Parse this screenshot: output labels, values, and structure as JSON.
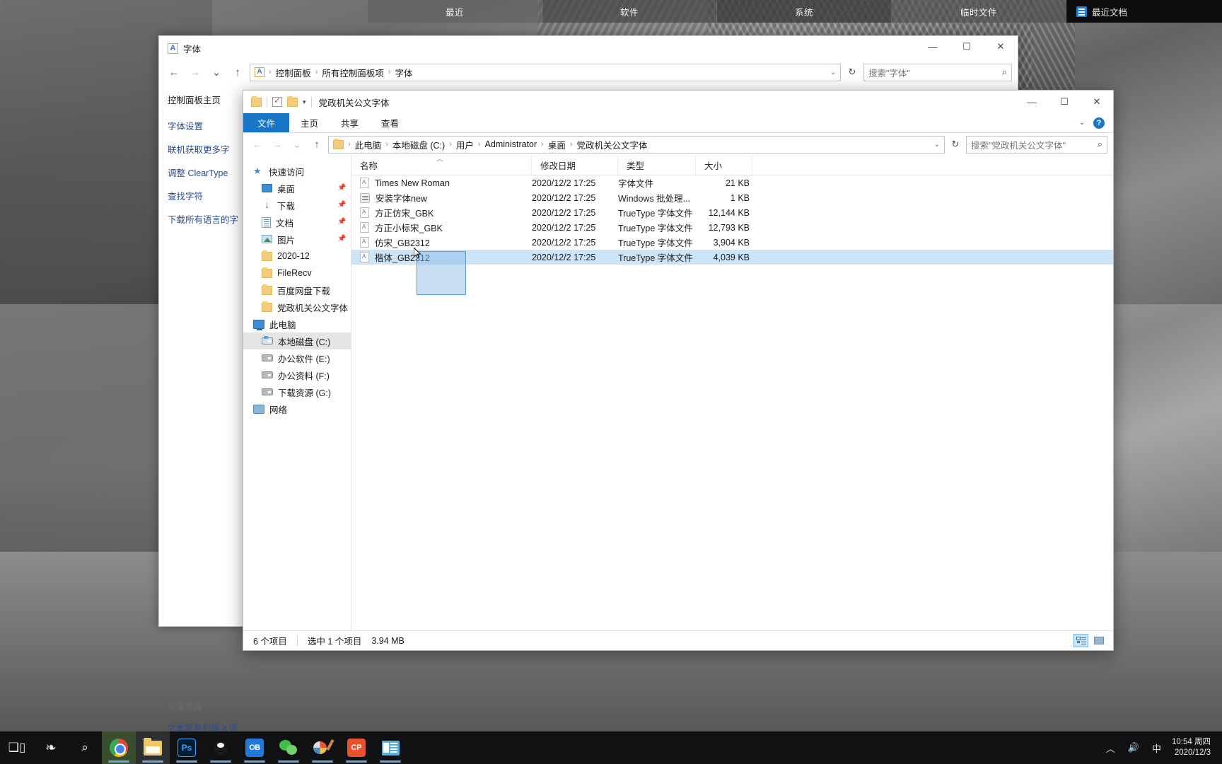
{
  "topbar": {
    "tabs": [
      "最近",
      "软件",
      "系统",
      "临时文件"
    ],
    "doc_panel": {
      "label": "最近文档",
      "icon": "recent-doc-icon"
    }
  },
  "control_panel": {
    "title": "字体",
    "title_icon": "fonts-icon",
    "nav": {
      "back": "←",
      "forward": "→",
      "recent": "⌄",
      "up": "↑"
    },
    "address": {
      "icon": "fonts-icon",
      "crumbs": [
        "控制面板",
        "所有控制面板项",
        "字体"
      ],
      "separator": "›"
    },
    "refresh_icon": "refresh-icon",
    "search": {
      "placeholder": "搜索\"字体\"",
      "value": "",
      "icon": "search-icon"
    },
    "sidebar": {
      "home": "控制面板主页",
      "links": [
        "字体设置",
        "联机获取更多字",
        "调整 ClearType ",
        "查找字符",
        "下载所有语言的字"
      ],
      "see_also_heading": "另请参阅",
      "see_also_links": [
        "文本服务和输入语"
      ]
    },
    "window_buttons": {
      "minimize": "—",
      "maximize": "☐",
      "close": "✕"
    }
  },
  "explorer": {
    "quick_access_toolbar": {
      "folder_icon": "folder-icon",
      "properties_icon": "properties-checkbox-icon",
      "new_folder_icon": "new-folder-icon",
      "dropdown_icon": "chevron-down-icon",
      "title": "党政机关公文字体"
    },
    "window_buttons": {
      "minimize": "—",
      "maximize": "☐",
      "close": "✕"
    },
    "ribbon_tabs": [
      "文件",
      "主页",
      "共享",
      "查看"
    ],
    "ribbon_right": {
      "collapse_icon": "chevron-down-icon",
      "help": "?"
    },
    "nav": {
      "back": "←",
      "forward": "→",
      "recent": "⌄",
      "up": "↑"
    },
    "address": {
      "icon": "folder-icon",
      "crumbs": [
        "此电脑",
        "本地磁盘 (C:)",
        "用户",
        "Administrator",
        "桌面",
        "党政机关公文字体"
      ],
      "separator": "›"
    },
    "refresh_icon": "refresh-icon",
    "search": {
      "placeholder": "搜索\"党政机关公文字体\"",
      "value": "",
      "icon": "search-icon"
    },
    "tree": [
      {
        "label": "快速访问",
        "icon": "star-icon",
        "indent": false,
        "pinned": false,
        "selected": false
      },
      {
        "label": "桌面",
        "icon": "desktop-icon",
        "indent": true,
        "pinned": true,
        "selected": false
      },
      {
        "label": "下载",
        "icon": "downloads-icon",
        "indent": true,
        "pinned": true,
        "selected": false
      },
      {
        "label": "文档",
        "icon": "documents-icon",
        "indent": true,
        "pinned": true,
        "selected": false
      },
      {
        "label": "图片",
        "icon": "pictures-icon",
        "indent": true,
        "pinned": true,
        "selected": false
      },
      {
        "label": "2020-12",
        "icon": "folder-icon",
        "indent": true,
        "pinned": false,
        "selected": false
      },
      {
        "label": "FileRecv",
        "icon": "folder-icon",
        "indent": true,
        "pinned": false,
        "selected": false
      },
      {
        "label": "百度网盘下载",
        "icon": "folder-icon",
        "indent": true,
        "pinned": false,
        "selected": false
      },
      {
        "label": "党政机关公文字体",
        "icon": "folder-icon",
        "indent": true,
        "pinned": false,
        "selected": false
      },
      {
        "label": "此电脑",
        "icon": "this-pc-icon",
        "indent": false,
        "pinned": false,
        "selected": false
      },
      {
        "label": "本地磁盘 (C:)",
        "icon": "system-drive-icon",
        "indent": true,
        "pinned": false,
        "selected": true
      },
      {
        "label": "办公软件 (E:)",
        "icon": "drive-icon",
        "indent": true,
        "pinned": false,
        "selected": false
      },
      {
        "label": "办公资料 (F:)",
        "icon": "drive-icon",
        "indent": true,
        "pinned": false,
        "selected": false
      },
      {
        "label": "下载资源 (G:)",
        "icon": "drive-icon",
        "indent": true,
        "pinned": false,
        "selected": false
      },
      {
        "label": "网络",
        "icon": "network-icon",
        "indent": false,
        "pinned": false,
        "selected": false
      }
    ],
    "columns": [
      "名称",
      "修改日期",
      "类型",
      "大小"
    ],
    "sort": {
      "column": "名称",
      "direction": "ascending",
      "arrow": "︿"
    },
    "files": [
      {
        "name": "Times New Roman",
        "icon": "font-file-icon",
        "modified": "2020/12/2 17:25",
        "type": "字体文件",
        "size": "21 KB",
        "selected": false
      },
      {
        "name": "安装字体new",
        "icon": "batch-file-icon",
        "modified": "2020/12/2 17:25",
        "type": "Windows 批处理...",
        "size": "1 KB",
        "selected": false
      },
      {
        "name": "方正仿宋_GBK",
        "icon": "font-file-icon",
        "modified": "2020/12/2 17:25",
        "type": "TrueType 字体文件",
        "size": "12,144 KB",
        "selected": false
      },
      {
        "name": "方正小标宋_GBK",
        "icon": "font-file-icon",
        "modified": "2020/12/2 17:25",
        "type": "TrueType 字体文件",
        "size": "12,793 KB",
        "selected": false
      },
      {
        "name": "仿宋_GB2312",
        "icon": "font-file-icon",
        "modified": "2020/12/2 17:25",
        "type": "TrueType 字体文件",
        "size": "3,904 KB",
        "selected": false
      },
      {
        "name": "楷体_GB2312",
        "icon": "font-file-icon",
        "modified": "2020/12/2 17:25",
        "type": "TrueType 字体文件",
        "size": "4,039 KB",
        "selected": true
      }
    ],
    "status": {
      "item_count": "6 个项目",
      "selection": "选中 1 个项目",
      "selection_size": "3.94 MB"
    },
    "view_buttons": {
      "details": "details-view-icon",
      "tiles": "tiles-view-icon",
      "active": "details"
    }
  },
  "taskbar": {
    "buttons": [
      {
        "name": "task-view",
        "icon": "task-view-icon",
        "label": ""
      },
      {
        "name": "pinwheel-app",
        "icon": "pinwheel-icon",
        "label": ""
      },
      {
        "name": "search",
        "icon": "search-icon",
        "label": ""
      },
      {
        "name": "chrome",
        "icon": "chrome-icon",
        "label": ""
      },
      {
        "name": "file-explorer",
        "icon": "folder-icon",
        "label": ""
      },
      {
        "name": "photoshop",
        "icon": "photoshop-icon",
        "label": "Ps"
      },
      {
        "name": "qq",
        "icon": "qq-penguin-icon",
        "label": ""
      },
      {
        "name": "ob-app",
        "icon": "ob-icon",
        "label": "OB"
      },
      {
        "name": "wechat",
        "icon": "wechat-icon",
        "label": ""
      },
      {
        "name": "paint",
        "icon": "paint-palette-icon",
        "label": ""
      },
      {
        "name": "cp-app",
        "icon": "cp-icon",
        "label": "CP"
      },
      {
        "name": "notes-app",
        "icon": "notes-icon",
        "label": ""
      }
    ],
    "tray": {
      "show_hidden": "︿",
      "volume_icon": "speaker-icon",
      "ime": "中",
      "time": "10:54 周四",
      "date": "2020/12/3"
    }
  },
  "colors": {
    "accent": "#1975c5",
    "selection": "#cce4f7",
    "marquee_fill": "#8ab9e6",
    "marquee_border": "#5e9fd6",
    "taskbar_bg": "#111114"
  }
}
